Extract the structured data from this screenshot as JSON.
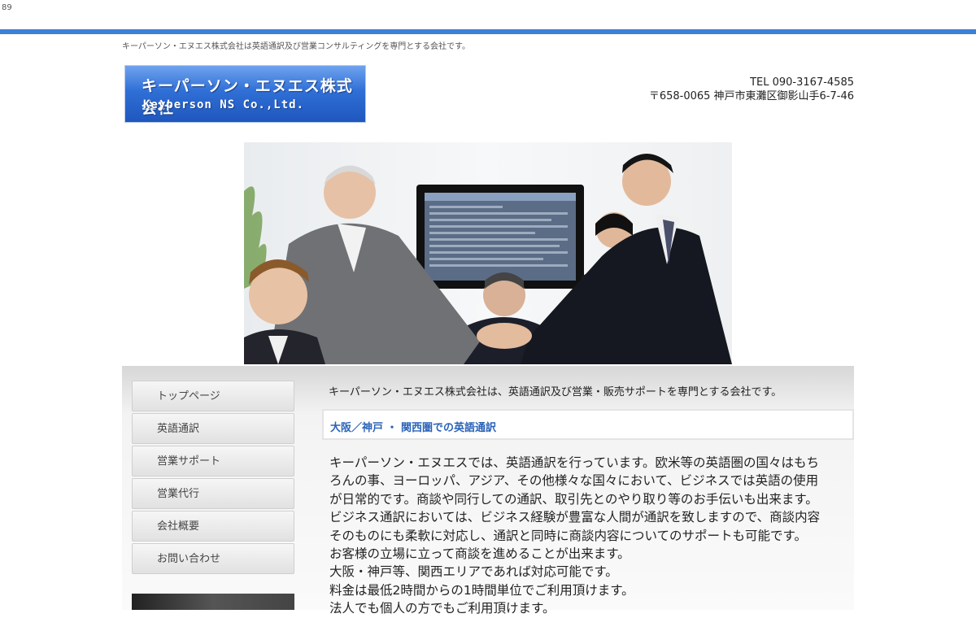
{
  "page_counter": "89",
  "header": {
    "tagline": "キーパーソン・エヌエス株式会社は英語通訳及び営業コンサルティングを専門とする会社です。",
    "logo": {
      "name_jp": "キーパーソン・エヌエス株式会社",
      "name_en": "Keyperson NS Co.,Ltd."
    },
    "contact": {
      "tel": "TEL 090-3167-4585",
      "address": "〒658-0065 神戸市東灘区御影山手6-7-46"
    }
  },
  "nav": {
    "items": [
      {
        "label": "トップページ"
      },
      {
        "label": "英語通訳"
      },
      {
        "label": "営業サポート"
      },
      {
        "label": "営業代行"
      },
      {
        "label": "会社概要"
      },
      {
        "label": "お問い合わせ"
      }
    ]
  },
  "main": {
    "intro": "キーパーソン・エヌエス株式会社は、英語通訳及び営業・販売サポートを専門とする会社です。",
    "heading": "大阪／神戸 ・ 関西圏での英語通訳",
    "paragraph_lines": [
      "キーパーソン・エヌエスでは、英語通訳を行っています。欧米等の英語圏の国々はもち",
      "ろんの事、ヨーロッパ、アジア、その他様々な国々において、ビジネスでは英語の使用",
      "が日常的です。商談や同行しての通訳、取引先とのやり取り等のお手伝いも出来ます。",
      "ビジネス通訳においては、ビジネス経験が豊富な人間が通訳を致しますので、商談内容",
      "そのものにも柔軟に対応し、通訳と同時に商談内容についてのサポートも可能です。",
      "お客様の立場に立って商談を進めることが出来ます。",
      "大阪・神戸等、関西エリアであれば対応可能です。",
      "料金は最低2時間からの1時間単位でご利用頂けます。",
      "法人でも個人の方でもご利用頂けます。"
    ]
  },
  "colors": {
    "accent": "#3d7fd9",
    "heading": "#2a62b8"
  }
}
